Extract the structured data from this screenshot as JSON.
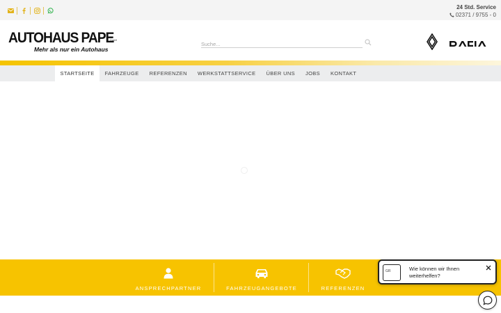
{
  "topbar": {
    "social_icons": [
      "envelope-icon",
      "facebook-icon",
      "instagram-icon",
      "whatsapp-icon"
    ],
    "service_title": "24 Std. Service",
    "service_phone": "02371 / 9755 - 0"
  },
  "header": {
    "logo_name": "AUTOHAUS PAPE",
    "logo_suffix": "GmbH",
    "logo_slogan": "Mehr als nur ein Autohaus",
    "search_placeholder": "Suche...",
    "brands": [
      "renault-logo",
      "DACIA"
    ]
  },
  "nav": {
    "items": [
      {
        "label": "STARTSEITE",
        "active": true
      },
      {
        "label": "FAHRZEUGE"
      },
      {
        "label": "REFERENZEN"
      },
      {
        "label": "WERKSTATTSERVICE"
      },
      {
        "label": "ÜBER UNS"
      },
      {
        "label": "JOBS"
      },
      {
        "label": "KONTAKT"
      }
    ]
  },
  "footer_band": {
    "tiles": [
      {
        "label": "ANSPRECHPARTNER",
        "icon": "person-icon"
      },
      {
        "label": "FAHRZEUGANGEBOTE",
        "icon": "car-icon"
      },
      {
        "label": "REFERENZEN",
        "icon": "handshake-icon"
      }
    ]
  },
  "chat": {
    "message": "Wie können wir Ihnen weiterhelfen?",
    "avatar_text": "GR"
  },
  "colors": {
    "accent": "#f7c300",
    "nav_bg": "#ecedee",
    "topbar_bg": "#f4f4f4"
  }
}
